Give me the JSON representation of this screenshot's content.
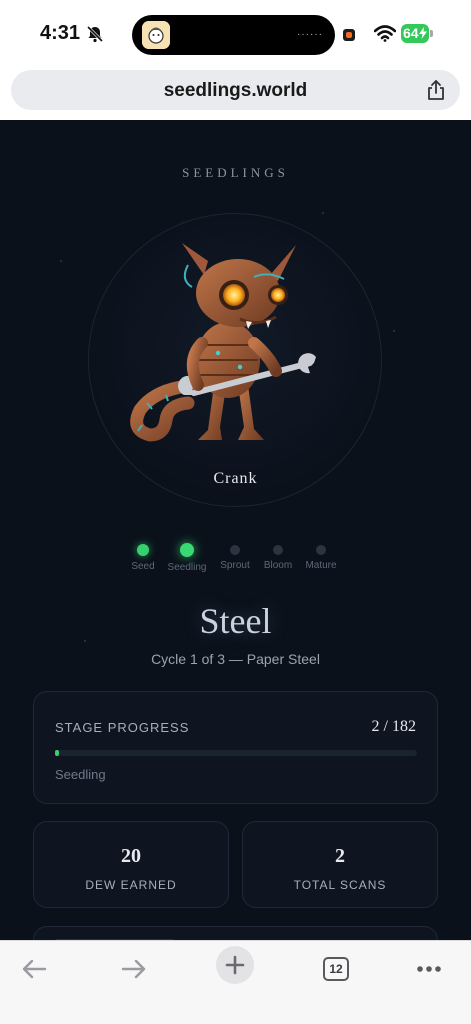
{
  "status_bar": {
    "time": "4:31",
    "battery": "64",
    "icons": [
      "bell-slash-icon",
      "wifi-icon",
      "battery-charging-icon",
      "screen-recording-icon"
    ]
  },
  "browser": {
    "url": "seedlings.world",
    "open_tab_count": "12",
    "icons": [
      "share-icon",
      "back-icon",
      "forward-icon",
      "plus-icon",
      "tabs-icon",
      "more-icon"
    ]
  },
  "app": {
    "brand": "SEEDLINGS",
    "creature_name": "Crank",
    "stages": [
      {
        "label": "Seed",
        "state": "active"
      },
      {
        "label": "Seedling",
        "state": "current"
      },
      {
        "label": "Sprout",
        "state": "inactive"
      },
      {
        "label": "Bloom",
        "state": "inactive"
      },
      {
        "label": "Mature",
        "state": "inactive"
      }
    ],
    "cycle_title": "Steel",
    "cycle_subtitle": "Cycle 1 of 3 — Paper Steel",
    "progress": {
      "label": "STAGE PROGRESS",
      "count": "2 / 182",
      "current": 2,
      "total": 182,
      "stage": "Seedling"
    },
    "stats": [
      {
        "value": "20",
        "label": "DEW EARNED"
      },
      {
        "value": "2",
        "label": "TOTAL SCANS"
      }
    ],
    "colors": {
      "background": "#0b111b",
      "accent_green": "#36d16c",
      "card_border": "#1f2937"
    }
  }
}
